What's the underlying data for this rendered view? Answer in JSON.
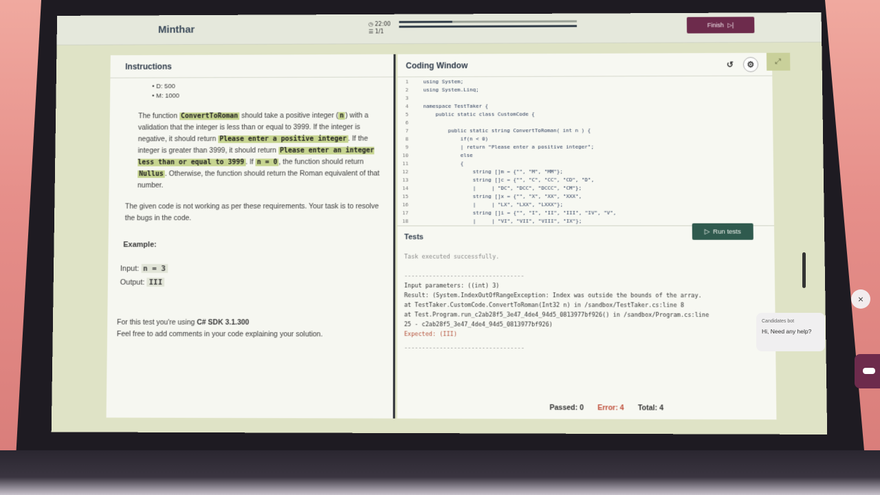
{
  "header": {
    "brand": "Minthar",
    "timer": "22:00",
    "question_count": "1/1",
    "finish_label": "Finish"
  },
  "instructions": {
    "title": "Instructions",
    "list": [
      "D: 500",
      "M: 1000"
    ],
    "p1_a": "The function",
    "p1_fn": "ConvertToRoman",
    "p1_b": "should take a positive integer (",
    "p1_n": "n",
    "p1_c": ") with a validation that the integer is less than or equal to 3999. If the integer is negative, it should return",
    "p1_msg1": "Please enter a positive integer",
    "p1_d": ". If the integer is greater than 3999, it should return",
    "p1_msg2": "Please enter an integer less than or equal to 3999",
    "p1_e": ". If",
    "p1_zero": "n = 0",
    "p1_f": ", the function should return",
    "p1_null": "Nullus",
    "p1_g": ". Otherwise, the function should return the Roman equivalent of that number.",
    "p2": "The given code is not working as per these requirements. Your task is to resolve the bugs in the code.",
    "example_title": "Example:",
    "input_label": "Input:",
    "input_value": "n = 3",
    "output_label": "Output:",
    "output_value": "III",
    "sdk_a": "For this test you're using",
    "sdk_b": "C# SDK 3.1.300",
    "sdk_c": "Feel free to add comments in your code explaining your solution."
  },
  "coding": {
    "title": "Coding Window",
    "lines": [
      "   using System;",
      "   using System.Linq;",
      "",
      "   namespace TestTaker {",
      "       public static class CustomCode {",
      "",
      "           public static string ConvertToRoman( int n ) {",
      "               if(n < 0)",
      "               | return \"Please enter a positive integer\";",
      "               else",
      "               {",
      "                   string []m = {\"\", \"M\", \"MM\"};",
      "                   string []c = {\"\", \"C\", \"CC\", \"CD\", \"D\",",
      "                   |     | \"DC\", \"DCC\", \"DCCC\", \"CM\"};",
      "                   string []x = {\"\", \"X\", \"XX\", \"XXX\",",
      "                   |     | \"LX\", \"LXX\", \"LXXX\"};",
      "                   string []i = {\"\", \"I\", \"II\", \"III\", \"IV\", \"V\",",
      "                   |     | \"VI\", \"VII\", \"VIII\", \"IX\"};"
    ],
    "run_label": "Run tests"
  },
  "tests": {
    "title": "Tests",
    "success": "Task executed successfully.",
    "separator": "----------------------------------",
    "input_params": "Input parameters: ((int) 3)",
    "result_1": "Result: (System.IndexOutOfRangeException: Index was outside the bounds of the array.",
    "result_2": "      at TestTaker.CustomCode.ConvertToRoman(Int32 n) in /sandbox/TestTaker.cs:line 8",
    "result_3": "      at Test.Program.run_c2ab28f5_3e47_4de4_94d5_0813977bf926() in /sandbox/Program.cs:line",
    "result_4": "25 - c2ab28f5_3e47_4de4_94d5_0813977bf926)",
    "expected": "Expected: (III)",
    "passed": "Passed: 0",
    "error": "Error: 4",
    "total": "Total: 4"
  },
  "chatbot": {
    "name": "Candidates bot",
    "message": "Hi, Need any help?"
  }
}
